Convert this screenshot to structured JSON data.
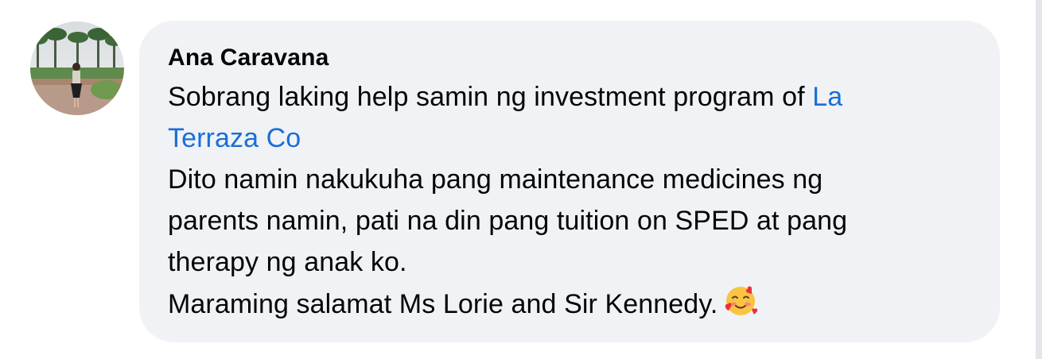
{
  "comment": {
    "author": "Ana Caravana",
    "lines": [
      {
        "text": "Sobrang laking help samin ng investment program of ",
        "mention": "La"
      },
      {
        "text": "",
        "mention": "Terraza Co"
      },
      {
        "text": "Dito namin nakukuha pang maintenance medicines ng",
        "mention": ""
      },
      {
        "text": "parents namin, pati na din pang tuition on SPED at pang",
        "mention": ""
      },
      {
        "text": "therapy ng anak ko.",
        "mention": ""
      },
      {
        "text": "Maraming salamat Ms Lorie and Sir Kennedy.",
        "mention": ""
      }
    ],
    "emoji": "smiling-face-with-hearts"
  },
  "colors": {
    "bubble": "#f0f2f5",
    "text": "#050505",
    "mention": "#1a6ed8"
  }
}
